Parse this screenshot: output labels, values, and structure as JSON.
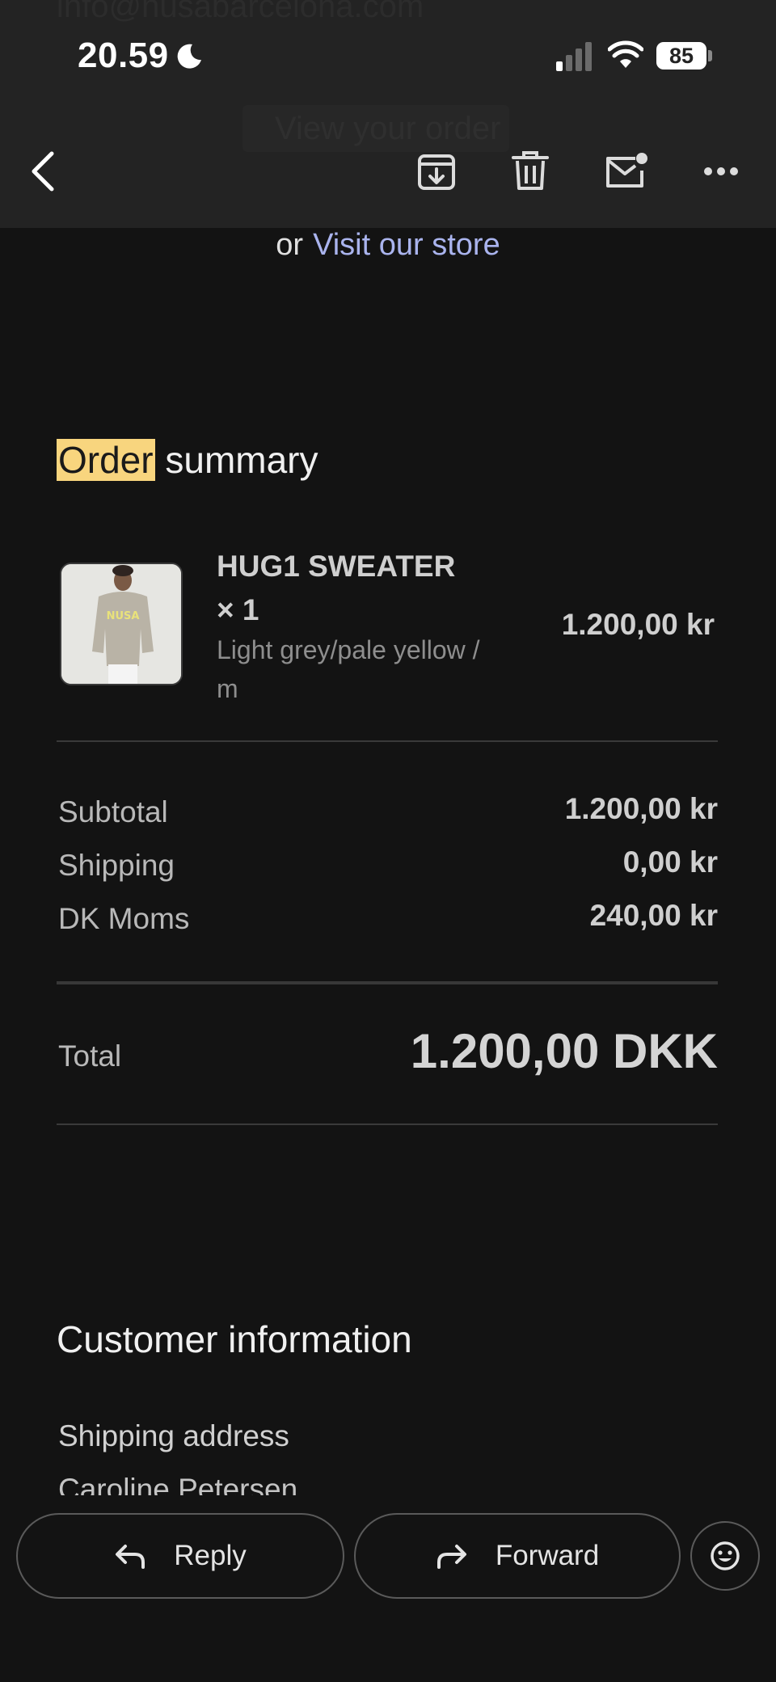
{
  "status_bar": {
    "time": "20.59",
    "battery": "85"
  },
  "header_ghost": {
    "line_text": "info@nusabarcelona.com",
    "button_text": "View your order"
  },
  "toolbar": {
    "back_icon": "chevron-left-icon",
    "archive_icon": "archive-icon",
    "delete_icon": "trash-icon",
    "mark_unread_icon": "mail-unread-icon",
    "more_icon": "more-horizontal-icon"
  },
  "email": {
    "visit": {
      "prefix": "or",
      "link_text": "Visit our store"
    },
    "order_summary": {
      "title_highlight": "Order",
      "title_rest": " summary",
      "product": {
        "name": "HUG1 SWEATER × 1",
        "variant": "Light grey/pale yellow / m",
        "price": "1.200,00 kr",
        "image_label": "NUSA"
      },
      "rows": [
        {
          "label": "Subtotal",
          "value": "1.200,00 kr"
        },
        {
          "label": "Shipping",
          "value": "0,00 kr"
        },
        {
          "label": "DK Moms",
          "value": "240,00 kr"
        }
      ],
      "total": {
        "label": "Total",
        "value": "1.200,00 DKK"
      }
    },
    "customer": {
      "title": "Customer information",
      "shipping_label": "Shipping address",
      "shipping_name": "Caroline Petersen"
    }
  },
  "actions": {
    "reply": "Reply",
    "forward": "Forward",
    "emoji_icon": "emoji-reaction-icon"
  },
  "colors": {
    "background": "#131313",
    "toolbar": "#232323",
    "link": "#aab4ee",
    "highlight": "#f8d57e"
  }
}
